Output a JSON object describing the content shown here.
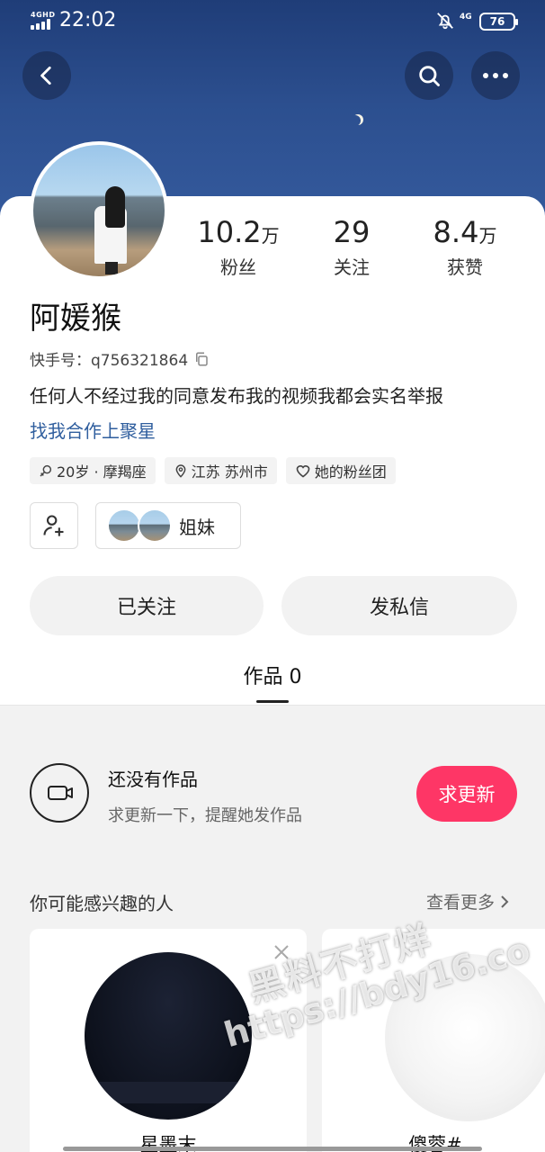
{
  "status_bar": {
    "network_top": "4GHD",
    "time": "22:02",
    "network": "4G",
    "battery": "76"
  },
  "header": {
    "back_icon": "back-arrow-icon",
    "search_icon": "search-icon",
    "more_icon": "more-dots-icon"
  },
  "profile": {
    "stats": [
      {
        "value": "10.2",
        "unit": "万",
        "label": "粉丝"
      },
      {
        "value": "29",
        "unit": "",
        "label": "关注"
      },
      {
        "value": "8.4",
        "unit": "万",
        "label": "获赞"
      }
    ],
    "name": "阿媛猴",
    "kuaishou_id": "快手号：q756321864",
    "bio": "任何人不经过我的同意发布我的视频我都会实名举报",
    "link": "找我合作上聚星",
    "tags": [
      {
        "icon": "gender-female-icon",
        "text": "20岁 · 摩羯座"
      },
      {
        "icon": "location-pin-icon",
        "text": "江苏 苏州市"
      },
      {
        "icon": "heart-icon",
        "text": "她的粉丝团"
      }
    ],
    "sisters_label": "姐妹"
  },
  "actions": {
    "followed": "已关注",
    "message": "发私信"
  },
  "tabs": {
    "works": "作品 0"
  },
  "empty_state": {
    "title": "还没有作品",
    "subtitle": "求更新一下，提醒她发作品",
    "button": "求更新"
  },
  "suggestions": {
    "title": "你可能感兴趣的人",
    "more": "查看更多",
    "people": [
      {
        "name": "星墨末"
      },
      {
        "name": "傻蓉#"
      }
    ]
  },
  "watermark": {
    "line1": "黑料不打烊",
    "line2": "https://bdy16.co"
  },
  "colors": {
    "accent": "#fe3666",
    "link": "#2f5e9e",
    "header_bg": "#2c4f8f"
  }
}
